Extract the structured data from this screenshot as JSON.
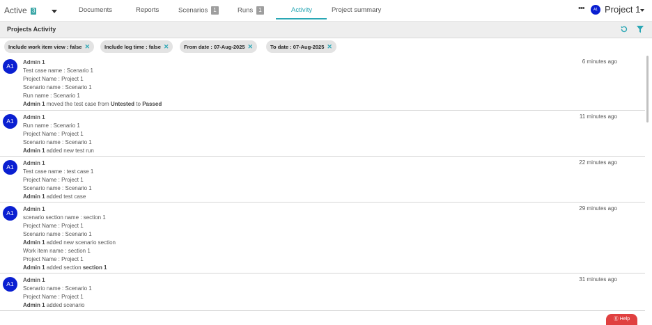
{
  "topnav": {
    "status_label": "Active",
    "status_count": "3",
    "tabs": [
      {
        "label": "Documents",
        "count": ""
      },
      {
        "label": "Reports",
        "count": ""
      },
      {
        "label": "Scenarios",
        "count": "1"
      },
      {
        "label": "Runs",
        "count": "1"
      },
      {
        "label": "Activity",
        "count": ""
      },
      {
        "label": "Project summary",
        "count": ""
      }
    ],
    "active_tab": "Activity",
    "more": "•••",
    "project_avatar": "A1",
    "project_name": "Project 1"
  },
  "header": {
    "title": "Projects Activity",
    "refresh_icon": "refresh-icon",
    "filter_icon": "filter-icon"
  },
  "filters": [
    {
      "label": "Include work item view :",
      "value": "false"
    },
    {
      "label": "Include log time :",
      "value": "false"
    },
    {
      "label": "From date :",
      "value": "07-Aug-2025"
    },
    {
      "label": "To date :",
      "value": "07-Aug-2025"
    }
  ],
  "activities": [
    {
      "avatar": "A1",
      "user": "Admin 1",
      "time": "6 minutes ago",
      "lines": [
        "Test case name : Scenario 1",
        "Project Name : Project 1",
        "Scenario name : Scenario 1",
        "Run name : Scenario 1"
      ],
      "action": {
        "user": "Admin 1",
        "text1": " moved the test case from ",
        "from": "Untested",
        "text2": " to ",
        "to": "Passed"
      }
    },
    {
      "avatar": "A1",
      "user": "Admin 1",
      "time": "11 minutes ago",
      "lines": [
        "Run name : Scenario 1",
        "Project Name : Project 1",
        "Scenario name : Scenario 1"
      ],
      "action": {
        "user": "Admin 1",
        "text1": "  added new test run"
      }
    },
    {
      "avatar": "A1",
      "user": "Admin 1",
      "time": "22 minutes ago",
      "lines": [
        "Test case name : test case 1",
        "Project Name : Project 1",
        "Scenario name : Scenario 1"
      ],
      "action": {
        "user": "Admin 1",
        "text1": "  added test case"
      }
    },
    {
      "avatar": "A1",
      "user": "Admin 1",
      "time": "29 minutes ago",
      "lines": [
        "scenario section name : section 1",
        "Project Name : Project 1",
        "Scenario name : Scenario 1"
      ],
      "action": {
        "user": "Admin 1",
        "text1": "  added new scenario section"
      },
      "lines2": [
        "Work item name : section 1",
        "Project Name : Project 1"
      ],
      "action2": {
        "user": "Admin 1",
        "text1": " added section ",
        "target": "section 1"
      }
    },
    {
      "avatar": "A1",
      "user": "Admin 1",
      "time": "31 minutes ago",
      "lines": [
        "Scenario name : Scenario 1",
        "Project Name : Project 1"
      ],
      "action": {
        "user": "Admin 1",
        "text1": "  added scenario"
      }
    }
  ],
  "help": {
    "label": "⓪ Help"
  }
}
